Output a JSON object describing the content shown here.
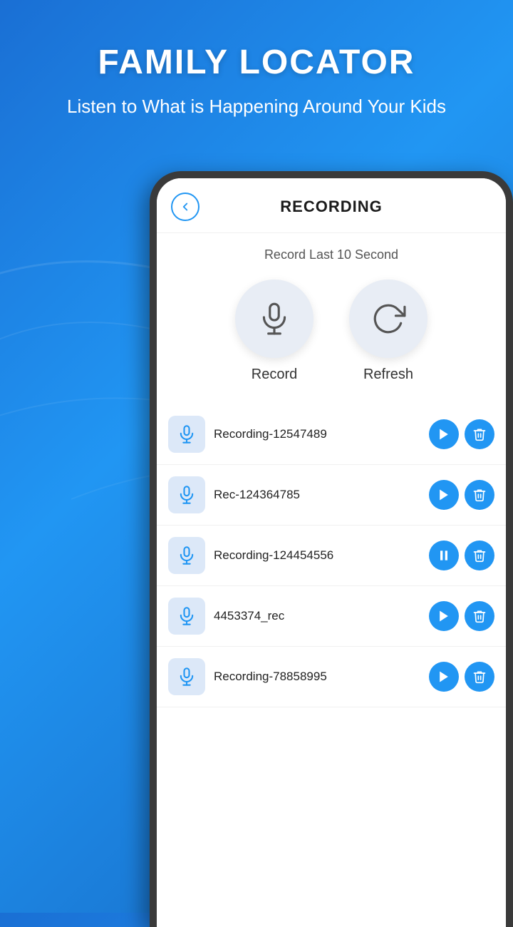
{
  "background": {
    "gradient_start": "#1a6fd4",
    "gradient_end": "#1565C0"
  },
  "header": {
    "title": "FAMILY LOCATOR",
    "subtitle": "Listen to What is Happening Around Your Kids"
  },
  "screen": {
    "title": "RECORDING",
    "subtitle": "Record Last 10 Second",
    "record_label": "Record",
    "refresh_label": "Refresh"
  },
  "recordings": [
    {
      "id": 1,
      "name": "Recording-12547489",
      "state": "play"
    },
    {
      "id": 2,
      "name": "Rec-124364785",
      "state": "play"
    },
    {
      "id": 3,
      "name": "Recording-124454556",
      "state": "pause"
    },
    {
      "id": 4,
      "name": "4453374_rec",
      "state": "play"
    },
    {
      "id": 5,
      "name": "Recording-78858995",
      "state": "play"
    }
  ]
}
